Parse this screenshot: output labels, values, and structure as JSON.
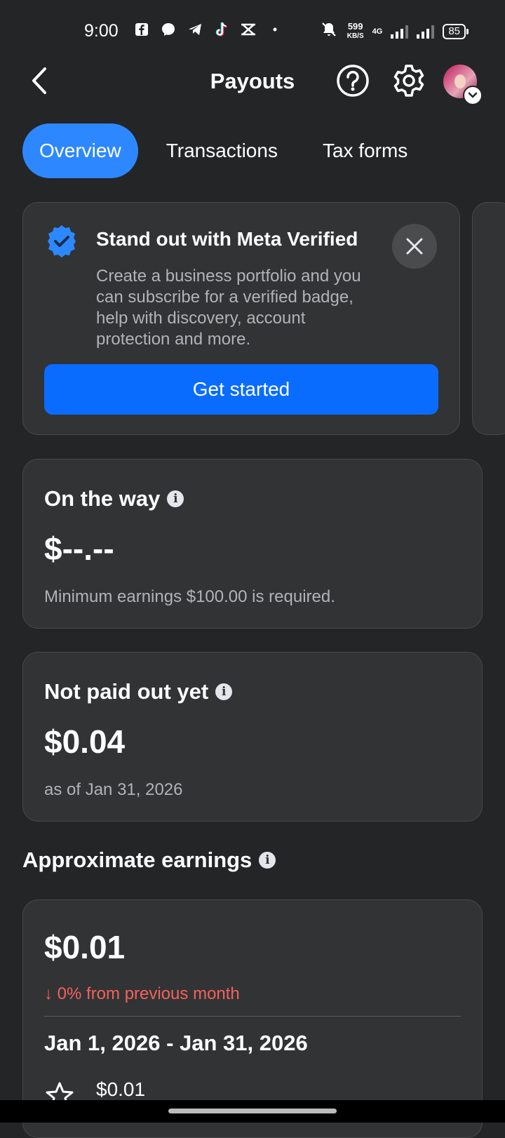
{
  "status_bar": {
    "time": "9:00",
    "speed_top": "599",
    "speed_bottom": "KB/S",
    "network": "4G",
    "battery": "85"
  },
  "header": {
    "title": "Payouts"
  },
  "tabs": [
    {
      "label": "Overview",
      "active": true
    },
    {
      "label": "Transactions",
      "active": false
    },
    {
      "label": "Tax forms",
      "active": false
    }
  ],
  "promo": {
    "title": "Stand out with Meta Verified",
    "body": "Create a business portfolio and you can subscribe for a verified badge, help with discovery, account protection and more.",
    "cta": "Get started"
  },
  "on_the_way": {
    "title": "On the way",
    "value": "$--.--",
    "subtitle": "Minimum earnings $100.00 is required."
  },
  "not_paid": {
    "title": "Not paid out yet",
    "value": "$0.04",
    "subtitle": "as of Jan 31, 2026"
  },
  "approximate": {
    "heading": "Approximate earnings",
    "value": "$0.01",
    "change": "↓ 0% from previous month",
    "range": "Jan 1, 2026 - Jan 31, 2026",
    "row_value": "$0.01"
  },
  "colors": {
    "background": "#242526",
    "card": "#323334",
    "accent": "#2d88ff",
    "cta": "#0a6cff",
    "negative": "#f3625d"
  }
}
